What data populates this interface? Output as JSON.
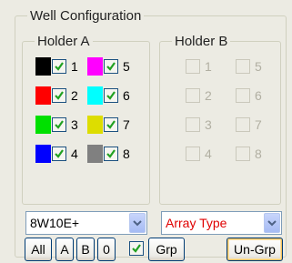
{
  "group_title": "Well Configuration",
  "holder_a": {
    "title": "Holder A",
    "wells": [
      {
        "num": "1",
        "color": "#000000",
        "checked": true
      },
      {
        "num": "2",
        "color": "#ff0000",
        "checked": true
      },
      {
        "num": "3",
        "color": "#00e000",
        "checked": true
      },
      {
        "num": "4",
        "color": "#0000ff",
        "checked": true
      },
      {
        "num": "5",
        "color": "#ff00ff",
        "checked": true
      },
      {
        "num": "6",
        "color": "#00ffff",
        "checked": true
      },
      {
        "num": "7",
        "color": "#dddd00",
        "checked": true
      },
      {
        "num": "8",
        "color": "#808080",
        "checked": true
      }
    ]
  },
  "holder_b": {
    "title": "Holder B",
    "wells": [
      {
        "num": "1",
        "checked": false
      },
      {
        "num": "2",
        "checked": false
      },
      {
        "num": "3",
        "checked": false
      },
      {
        "num": "4",
        "checked": false
      },
      {
        "num": "5",
        "checked": false
      },
      {
        "num": "6",
        "checked": false
      },
      {
        "num": "7",
        "checked": false
      },
      {
        "num": "8",
        "checked": false
      }
    ]
  },
  "plate_select": {
    "value": "8W10E+"
  },
  "array_select": {
    "value": "Array Type",
    "color": "#e00000"
  },
  "buttons": {
    "all": "All",
    "a": "A",
    "b": "B",
    "zero": "0",
    "grp": "Grp",
    "ungrp": "Un-Grp"
  },
  "grp_checkbox": {
    "checked": true
  }
}
